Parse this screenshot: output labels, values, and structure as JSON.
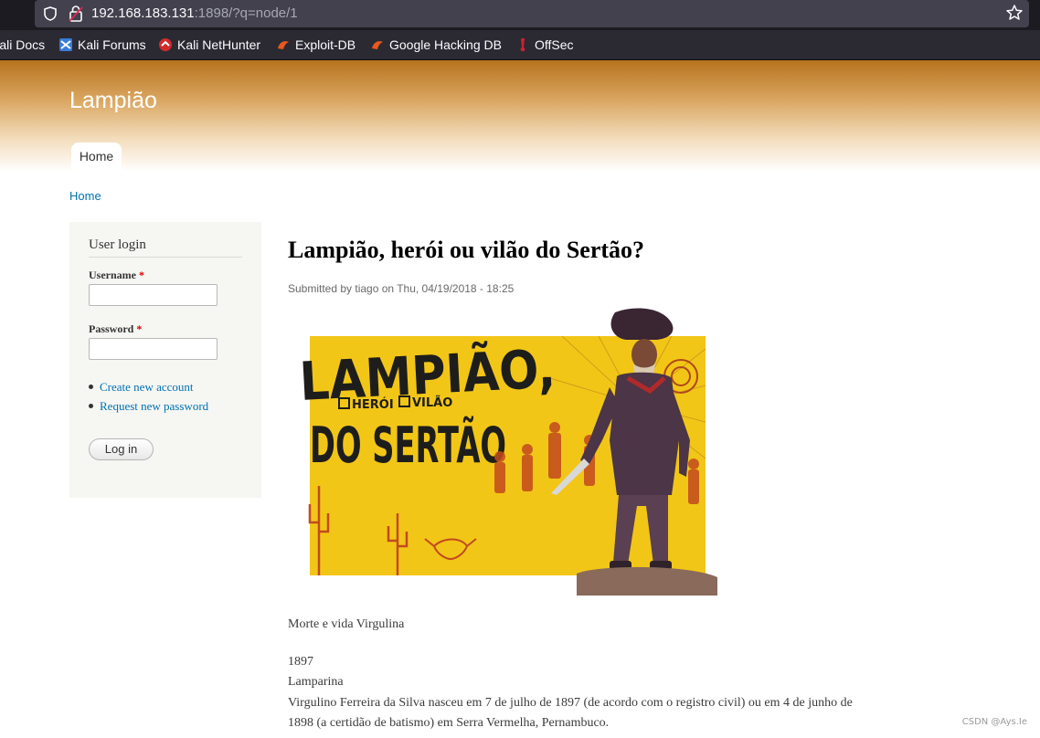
{
  "browser": {
    "url_host": "192.168.183.131",
    "url_rest": ":1898/?q=node/1",
    "bookmarks": [
      "Kali Docs",
      "Kali Forums",
      "Kali NetHunter",
      "Exploit-DB",
      "Google Hacking DB",
      "OffSec"
    ]
  },
  "site": {
    "name": "Lampião",
    "nav": {
      "home": "Home"
    },
    "breadcrumb": "Home"
  },
  "login": {
    "title": "User login",
    "username_label": "Username",
    "password_label": "Password",
    "required_mark": "*",
    "username_value": "",
    "password_value": "",
    "links": [
      "Create new account",
      "Request new password"
    ],
    "submit": "Log in"
  },
  "article": {
    "title": "Lampião, herói ou vilão do Sertão?",
    "submitted": "Submitted by tiago on Thu, 04/19/2018 - 18:25",
    "image": {
      "headline_1": "LAMPIÃO,",
      "check_1": "HERÓI",
      "check_2": "VILÃO",
      "headline_2": "DO SERTÃO"
    },
    "subtitle": "Morte e vida Virgulina",
    "year": "1897",
    "section": "Lamparina",
    "body_1": "Virgulino Ferreira da Silva nasceu em 7 de julho de 1897 (de acordo com o registro civil) ou em 4 de junho de",
    "body_2": "1898 (a certidão de batismo) em Serra Vermelha, Pernambuco."
  },
  "watermark": "CSDN @Ays.Ie",
  "colors": {
    "link": "#0071b3",
    "header_brown": "#b7731d",
    "poster_yellow": "#f2c617"
  }
}
